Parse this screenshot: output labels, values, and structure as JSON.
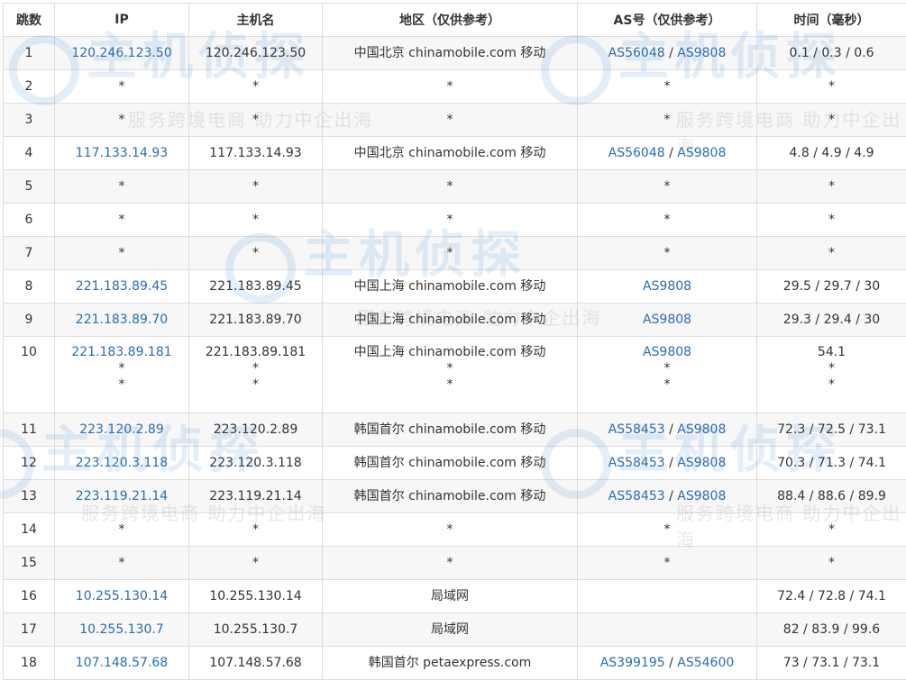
{
  "headers": [
    "跳数",
    "IP",
    "主机名",
    "地区（仅供参考）",
    "AS号（仅供参考）",
    "时间（毫秒）"
  ],
  "rows": [
    {
      "hop": "1",
      "ip": [
        "120.246.123.50"
      ],
      "host": [
        "120.246.123.50"
      ],
      "region": [
        "中国北京 chinamobile.com 移动"
      ],
      "as": [
        [
          "AS56048",
          "AS9808"
        ]
      ],
      "time": [
        "0.1 / 0.3 / 0.6"
      ]
    },
    {
      "hop": "2",
      "ip": [
        "*"
      ],
      "host": [
        "*"
      ],
      "region": [
        "*"
      ],
      "as": [
        [
          "*"
        ]
      ],
      "time": [
        "*"
      ]
    },
    {
      "hop": "3",
      "ip": [
        "*"
      ],
      "host": [
        "*"
      ],
      "region": [
        "*"
      ],
      "as": [
        [
          "*"
        ]
      ],
      "time": [
        "*"
      ]
    },
    {
      "hop": "4",
      "ip": [
        "117.133.14.93"
      ],
      "host": [
        "117.133.14.93"
      ],
      "region": [
        "中国北京 chinamobile.com 移动"
      ],
      "as": [
        [
          "AS56048",
          "AS9808"
        ]
      ],
      "time": [
        "4.8 / 4.9 / 4.9"
      ]
    },
    {
      "hop": "5",
      "ip": [
        "*"
      ],
      "host": [
        "*"
      ],
      "region": [
        "*"
      ],
      "as": [
        [
          "*"
        ]
      ],
      "time": [
        "*"
      ]
    },
    {
      "hop": "6",
      "ip": [
        "*"
      ],
      "host": [
        "*"
      ],
      "region": [
        "*"
      ],
      "as": [
        [
          "*"
        ]
      ],
      "time": [
        "*"
      ]
    },
    {
      "hop": "7",
      "ip": [
        "*"
      ],
      "host": [
        "*"
      ],
      "region": [
        "*"
      ],
      "as": [
        [
          "*"
        ]
      ],
      "time": [
        "*"
      ]
    },
    {
      "hop": "8",
      "ip": [
        "221.183.89.45"
      ],
      "host": [
        "221.183.89.45"
      ],
      "region": [
        "中国上海 chinamobile.com 移动"
      ],
      "as": [
        [
          "AS9808"
        ]
      ],
      "time": [
        "29.5 / 29.7 / 30"
      ]
    },
    {
      "hop": "9",
      "ip": [
        "221.183.89.70"
      ],
      "host": [
        "221.183.89.70"
      ],
      "region": [
        "中国上海 chinamobile.com 移动"
      ],
      "as": [
        [
          "AS9808"
        ]
      ],
      "time": [
        "29.3 / 29.4 / 30"
      ]
    },
    {
      "hop": "10",
      "ip": [
        "221.183.89.181",
        "*",
        "*"
      ],
      "host": [
        "221.183.89.181",
        "*",
        "*"
      ],
      "region": [
        "中国上海 chinamobile.com 移动",
        "*",
        "*"
      ],
      "as": [
        [
          "AS9808"
        ],
        [
          "*"
        ],
        [
          "*"
        ]
      ],
      "time": [
        "54.1",
        "*",
        "*"
      ]
    },
    {
      "hop": "11",
      "ip": [
        "223.120.2.89"
      ],
      "host": [
        "223.120.2.89"
      ],
      "region": [
        "韩国首尔 chinamobile.com 移动"
      ],
      "as": [
        [
          "AS58453",
          "AS9808"
        ]
      ],
      "time": [
        "72.3 / 72.5 / 73.1"
      ]
    },
    {
      "hop": "12",
      "ip": [
        "223.120.3.118"
      ],
      "host": [
        "223.120.3.118"
      ],
      "region": [
        "韩国首尔 chinamobile.com 移动"
      ],
      "as": [
        [
          "AS58453",
          "AS9808"
        ]
      ],
      "time": [
        "70.3 / 71.3 / 74.1"
      ]
    },
    {
      "hop": "13",
      "ip": [
        "223.119.21.14"
      ],
      "host": [
        "223.119.21.14"
      ],
      "region": [
        "韩国首尔 chinamobile.com 移动"
      ],
      "as": [
        [
          "AS58453",
          "AS9808"
        ]
      ],
      "time": [
        "88.4 / 88.6 / 89.9"
      ]
    },
    {
      "hop": "14",
      "ip": [
        "*"
      ],
      "host": [
        "*"
      ],
      "region": [
        "*"
      ],
      "as": [
        [
          "*"
        ]
      ],
      "time": [
        "*"
      ]
    },
    {
      "hop": "15",
      "ip": [
        "*"
      ],
      "host": [
        "*"
      ],
      "region": [
        "*"
      ],
      "as": [
        [
          "*"
        ]
      ],
      "time": [
        "*"
      ]
    },
    {
      "hop": "16",
      "ip": [
        "10.255.130.14"
      ],
      "host": [
        "10.255.130.14"
      ],
      "region": [
        "局域网"
      ],
      "as": [
        []
      ],
      "time": [
        "72.4 / 72.8 / 74.1"
      ]
    },
    {
      "hop": "17",
      "ip": [
        "10.255.130.7"
      ],
      "host": [
        "10.255.130.7"
      ],
      "region": [
        "局域网"
      ],
      "as": [
        []
      ],
      "time": [
        "82 / 83.9 / 99.6"
      ]
    },
    {
      "hop": "18",
      "ip": [
        "107.148.57.68"
      ],
      "host": [
        "107.148.57.68"
      ],
      "region": [
        "韩国首尔 petaexpress.com"
      ],
      "as": [
        [
          "AS399195",
          "AS54600"
        ]
      ],
      "time": [
        "73 / 73.1 / 73.1"
      ]
    }
  ],
  "watermark": {
    "logo": "主机侦探",
    "slogan": "服务跨境电商 助力中企出海"
  },
  "colors": {
    "link": "#2a6db0",
    "border": "#dddddd",
    "row_alt": "#f7f7f7",
    "watermark_blue": "#2a7fd4",
    "watermark_orange": "#f08a24"
  }
}
